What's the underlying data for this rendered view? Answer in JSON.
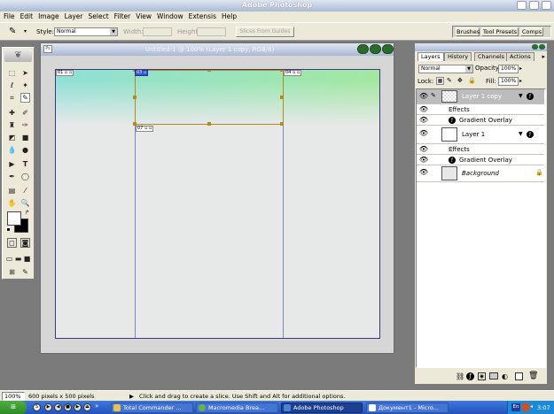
{
  "app": {
    "title": "Adobe Photoshop"
  },
  "menu": [
    "File",
    "Edit",
    "Image",
    "Layer",
    "Select",
    "Filter",
    "View",
    "Window",
    "Extensis",
    "Help"
  ],
  "options": {
    "style_label": "Style:",
    "style_value": "Normal",
    "width_label": "Width:",
    "height_label": "Height:",
    "slices_button": "Slices From Guides"
  },
  "palette_well": [
    "Brushes",
    "Tool Presets",
    "Comps"
  ],
  "document": {
    "title": "Untitled-1 @ 100% (Layer 1 copy, RGB/8)",
    "slices": [
      "01",
      "03",
      "04",
      "07"
    ]
  },
  "layers_panel": {
    "tabs": [
      "Layers",
      "History",
      "Channels",
      "Actions"
    ],
    "blend_mode": "Normal",
    "opacity_label": "Opacity:",
    "opacity_value": "100%",
    "lock_label": "Lock:",
    "fill_label": "Fill:",
    "fill_value": "100%",
    "layers": [
      {
        "name": "Layer 1 copy",
        "effects": "Effects",
        "effect": "Gradient Overlay"
      },
      {
        "name": "Layer 1",
        "effects": "Effects",
        "effect": "Gradient Overlay"
      },
      {
        "name": "Background"
      }
    ]
  },
  "status": {
    "zoom": "100%",
    "doc_size": "600 pixels x 500 pixels",
    "hint": "Click and drag to create a slice. Use Shift and Alt for additional options."
  },
  "taskbar": {
    "items": [
      "Total Commander ...",
      "Macromedia Brea...",
      "Adobe Photoshop",
      "Документ1 - Micro..."
    ],
    "lang": "En",
    "clock": "3:07"
  },
  "colors": {
    "canvas_gradient_top": "#8fe0d6",
    "canvas_gradient_right": "#a4e8a0",
    "canvas_body": "#e6e9e8",
    "slice_selection": "#b58a1c",
    "taskbar": "#2a5fcb"
  }
}
